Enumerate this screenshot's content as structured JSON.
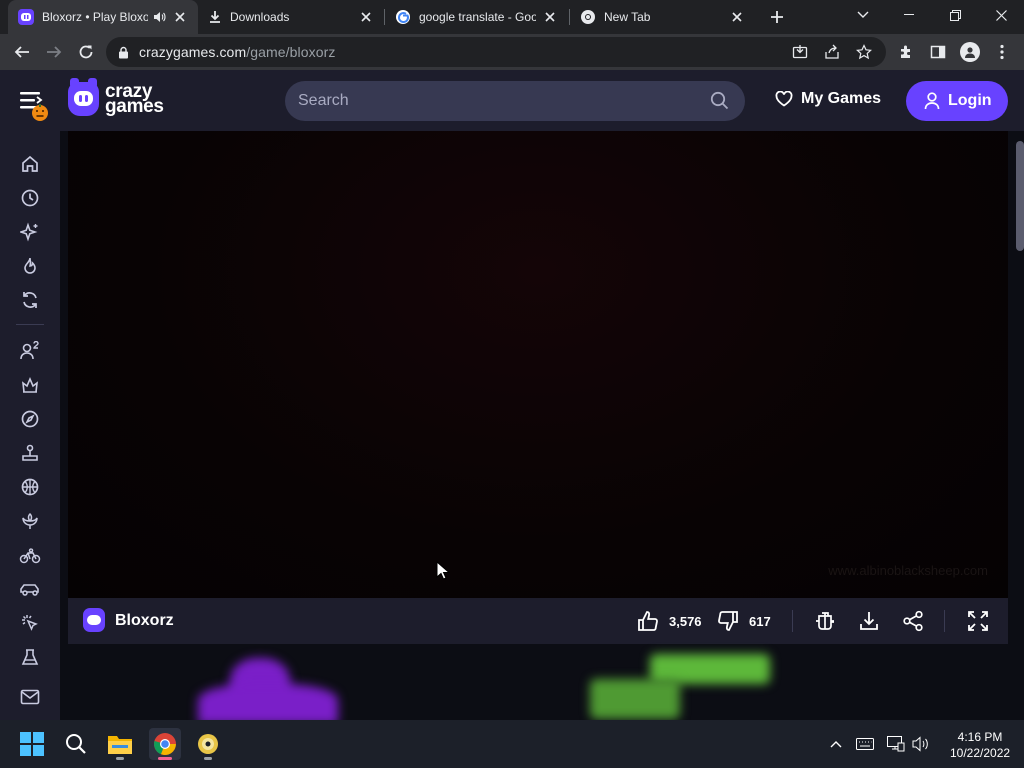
{
  "browser": {
    "tabs": [
      {
        "title": "Bloxorz • Play Bloxorz",
        "active": true
      },
      {
        "title": "Downloads",
        "active": false
      },
      {
        "title": "google translate - Google Search",
        "active": false
      },
      {
        "title": "New Tab",
        "active": false
      }
    ],
    "url_domain": "crazygames.com",
    "url_path": "/game/bloxorz"
  },
  "site": {
    "logo_line1": "crazy",
    "logo_line2": "games",
    "search_placeholder": "Search",
    "my_games_label": "My Games",
    "login_label": "Login",
    "brand_color": "#6842ff"
  },
  "sidebar": {
    "items": [
      {
        "icon": "home-icon"
      },
      {
        "icon": "recent-icon"
      },
      {
        "icon": "new-icon"
      },
      {
        "icon": "trending-icon"
      },
      {
        "icon": "updated-icon"
      },
      {
        "icon": "two-player-icon"
      },
      {
        "icon": "action-icon"
      },
      {
        "icon": "adventure-icon"
      },
      {
        "icon": "arcade-icon"
      },
      {
        "icon": "basketball-icon"
      },
      {
        "icon": "beauty-icon"
      },
      {
        "icon": "bike-icon"
      },
      {
        "icon": "car-icon"
      },
      {
        "icon": "clicker-icon"
      },
      {
        "icon": "casual-icon"
      },
      {
        "icon": "contact-icon"
      }
    ]
  },
  "game": {
    "title": "Bloxorz",
    "likes": "3,576",
    "dislikes": "617",
    "watermark": "www.albinoblacksheep.com"
  },
  "taskbar": {
    "time": "4:16 PM",
    "date": "10/22/2022"
  }
}
